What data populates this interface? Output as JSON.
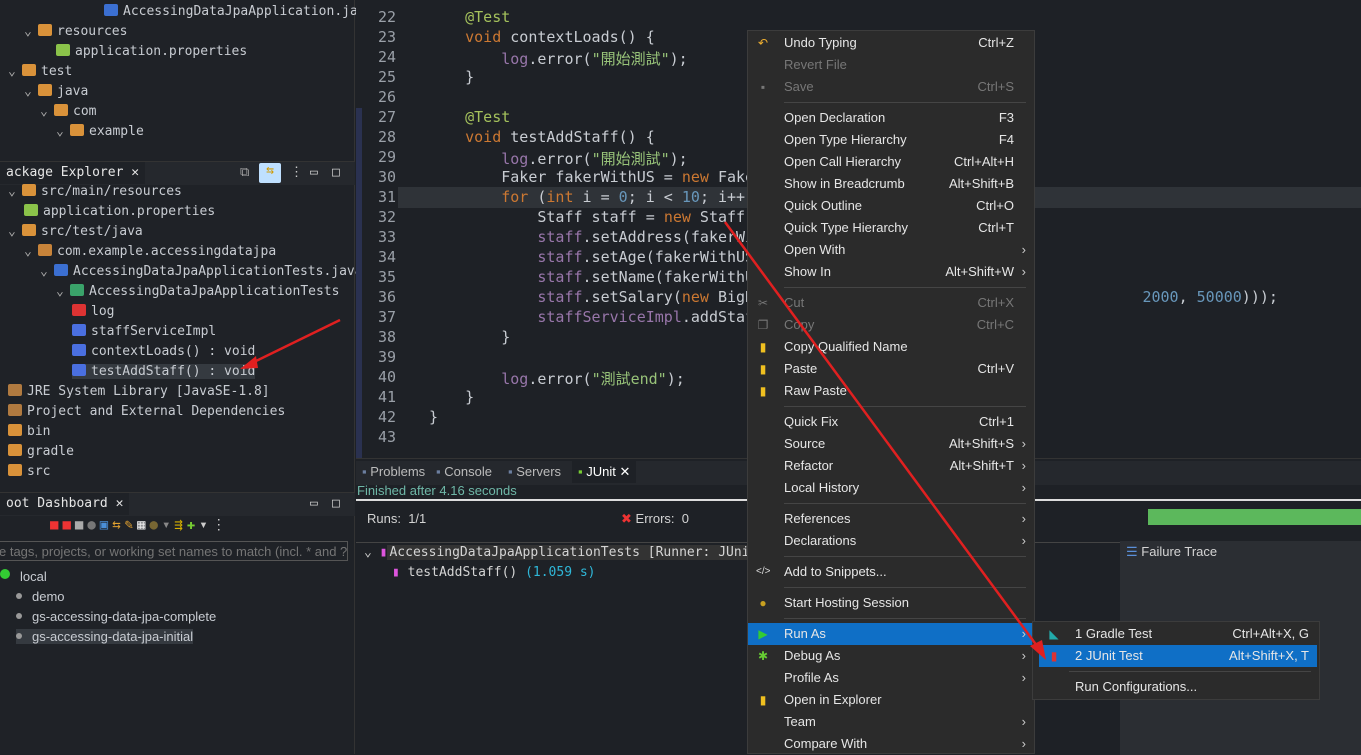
{
  "top_tree": [
    {
      "label": "AccessingDataJpaApplication.java",
      "indent": 104,
      "icon": "java-file-icon"
    },
    {
      "label": "resources",
      "indent": 24,
      "icon": "folder-icon",
      "chev": "v"
    },
    {
      "label": "application.properties",
      "indent": 56,
      "icon": "properties-icon"
    },
    {
      "label": "test",
      "indent": 8,
      "icon": "folder-icon",
      "chev": "v"
    },
    {
      "label": "java",
      "indent": 24,
      "icon": "folder-icon",
      "chev": "v"
    },
    {
      "label": "com",
      "indent": 40,
      "icon": "folder-icon",
      "chev": "v"
    },
    {
      "label": "example",
      "indent": 56,
      "icon": "folder-icon",
      "chev": "v"
    }
  ],
  "package_explorer": {
    "tab": "ackage Explorer",
    "items": [
      {
        "label": "src/main/resources",
        "indent": 8,
        "icon": "source-folder-icon",
        "chev": "v"
      },
      {
        "label": "application.properties",
        "indent": 24,
        "icon": "properties-icon"
      },
      {
        "label": "src/test/java",
        "indent": 8,
        "icon": "source-folder-icon",
        "chev": "v"
      },
      {
        "label": "com.example.accessingdatajpa",
        "indent": 24,
        "icon": "package-icon",
        "chev": "v"
      },
      {
        "label": "AccessingDataJpaApplicationTests.java",
        "indent": 40,
        "icon": "java-file-icon",
        "chev": "v"
      },
      {
        "label": "AccessingDataJpaApplicationTests",
        "indent": 56,
        "icon": "class-icon",
        "chev": "v"
      },
      {
        "label": "log",
        "indent": 72,
        "icon": "static-field-icon"
      },
      {
        "label": "staffServiceImpl",
        "indent": 72,
        "icon": "field-icon"
      },
      {
        "label": "contextLoads() : void",
        "indent": 72,
        "icon": "method-icon"
      },
      {
        "label": "testAddStaff() : void",
        "indent": 72,
        "icon": "method-icon",
        "selected": true
      },
      {
        "label": "JRE System Library [JavaSE-1.8]",
        "indent": 8,
        "icon": "library-icon"
      },
      {
        "label": "Project and External Dependencies",
        "indent": 8,
        "icon": "library-icon"
      },
      {
        "label": "bin",
        "indent": 8,
        "icon": "folder-icon"
      },
      {
        "label": "gradle",
        "indent": 8,
        "icon": "folder-icon"
      },
      {
        "label": "src",
        "indent": 8,
        "icon": "folder-icon"
      }
    ]
  },
  "boot_dashboard": {
    "tab": "oot Dashboard",
    "filter_placeholder": "e tags, projects, or working set names to match (incl. * and ? wi",
    "items": [
      {
        "label": "local",
        "indent": 0,
        "root": true
      },
      {
        "label": "demo",
        "indent": 16
      },
      {
        "label": "gs-accessing-data-jpa-complete",
        "indent": 16
      },
      {
        "label": "gs-accessing-data-jpa-initial",
        "indent": 16,
        "selected": true
      }
    ]
  },
  "editor": {
    "lines": [
      {
        "n": "22",
        "html": "    <span class='an'>@Test</span>"
      },
      {
        "n": "23",
        "html": "    <span class='kw'>void</span> contextLoads() {"
      },
      {
        "n": "24",
        "html": "        <span class='fld'>log</span>.error(<span class='st'>\"開始測試\"</span>);"
      },
      {
        "n": "25",
        "html": "    }"
      },
      {
        "n": "26",
        "html": ""
      },
      {
        "n": "27",
        "html": "    <span class='an'>@Test</span>"
      },
      {
        "n": "28",
        "html": "    <span class='kw'>void</span> testAddStaff() {"
      },
      {
        "n": "29",
        "html": "        <span class='fld'>log</span>.error(<span class='st'>\"開始測試\"</span>);"
      },
      {
        "n": "30",
        "html": "        Faker fakerWithUS = <span class='kw'>new</span> Faker(Locale"
      },
      {
        "n": "31",
        "html": "        <span class='kw'>for</span> (<span class='kw'>int</span> i = <span class='num'>0</span>; i &lt; <span class='num'>10</span>; i++) {"
      },
      {
        "n": "32",
        "html": "            Staff staff = <span class='kw'>new</span> Staff();"
      },
      {
        "n": "33",
        "html": "            <span class='fld'>staff</span>.setAddress(fakerWithUS.add"
      },
      {
        "n": "34",
        "html": "            <span class='fld'>staff</span>.setAge(fakerWithUS.number("
      },
      {
        "n": "35",
        "html": "            <span class='fld'>staff</span>.setName(fakerWithUS.name()"
      },
      {
        "n": "36",
        "html": "            <span class='fld'>staff</span>.setSalary(<span class='kw'>new</span> BigDecimal(f                                   <span class='num'>2000</span>, <span class='num'>50000</span>)));"
      },
      {
        "n": "37",
        "html": "            <span class='fld'>staffServiceImpl</span>.addStaff(staff)"
      },
      {
        "n": "38",
        "html": "        }"
      },
      {
        "n": "39",
        "html": ""
      },
      {
        "n": "40",
        "html": "        <span class='fld'>log</span>.error(<span class='st'>\"測試end\"</span>);"
      },
      {
        "n": "41",
        "html": "    }"
      },
      {
        "n": "42",
        "html": "}"
      },
      {
        "n": "43",
        "html": ""
      }
    ]
  },
  "bottom": {
    "tabs": [
      "Problems",
      "Console",
      "Servers",
      "JUnit"
    ],
    "status": "Finished after 4.16 seconds",
    "runs_label": "Runs:",
    "runs": "1/1",
    "errors_label": "Errors:",
    "errors": "0",
    "progress": 1.0,
    "progress_color": "#5cb85c",
    "failure_trace": "Failure Trace",
    "suite": "AccessingDataJpaApplicationTests [Runner: JUnit 5]",
    "test": "testAddStaff()",
    "time": "(1.059 s)"
  },
  "context_menu": [
    {
      "l": "Undo Typing",
      "s": "Ctrl+Z",
      "icon": "undo-icon"
    },
    {
      "l": "Revert File",
      "dis": true
    },
    {
      "l": "Save",
      "s": "Ctrl+S",
      "dis": true,
      "icon": "save-icon"
    },
    {
      "sep": true
    },
    {
      "l": "Open Declaration",
      "s": "F3"
    },
    {
      "l": "Open Type Hierarchy",
      "s": "F4"
    },
    {
      "l": "Open Call Hierarchy",
      "s": "Ctrl+Alt+H"
    },
    {
      "l": "Show in Breadcrumb",
      "s": "Alt+Shift+B"
    },
    {
      "l": "Quick Outline",
      "s": "Ctrl+O"
    },
    {
      "l": "Quick Type Hierarchy",
      "s": "Ctrl+T"
    },
    {
      "l": "Open With",
      "sub": true
    },
    {
      "l": "Show In",
      "s": "Alt+Shift+W",
      "sub": true
    },
    {
      "sep": true
    },
    {
      "l": "Cut",
      "s": "Ctrl+X",
      "dis": true,
      "icon": "cut-icon"
    },
    {
      "l": "Copy",
      "s": "Ctrl+C",
      "dis": true,
      "icon": "copy-icon"
    },
    {
      "l": "Copy Qualified Name",
      "icon": "copy-qualified-icon"
    },
    {
      "l": "Paste",
      "s": "Ctrl+V",
      "icon": "paste-icon"
    },
    {
      "l": "Raw Paste",
      "icon": "paste-icon"
    },
    {
      "sep": true
    },
    {
      "l": "Quick Fix",
      "s": "Ctrl+1"
    },
    {
      "l": "Source",
      "s": "Alt+Shift+S",
      "sub": true
    },
    {
      "l": "Refactor",
      "s": "Alt+Shift+T",
      "sub": true
    },
    {
      "l": "Local History",
      "sub": true
    },
    {
      "sep": true
    },
    {
      "l": "References",
      "sub": true
    },
    {
      "l": "Declarations",
      "sub": true
    },
    {
      "sep": true
    },
    {
      "l": "Add to Snippets...",
      "icon": "snippet-icon"
    },
    {
      "sep": true
    },
    {
      "l": "Start Hosting Session",
      "icon": "hosting-icon"
    },
    {
      "sep": true
    },
    {
      "l": "Run As",
      "sub": true,
      "sel": true,
      "icon": "run-icon"
    },
    {
      "l": "Debug As",
      "sub": true,
      "icon": "debug-icon"
    },
    {
      "l": "Profile As",
      "sub": true
    },
    {
      "l": "Open in Explorer",
      "icon": "explorer-icon"
    },
    {
      "l": "Team",
      "sub": true
    },
    {
      "l": "Compare With",
      "sub": true
    }
  ],
  "submenu": [
    {
      "l": "1 Gradle Test",
      "s": "Ctrl+Alt+X, G",
      "icon": "gradle-icon"
    },
    {
      "l": "2 JUnit Test",
      "s": "Alt+Shift+X, T",
      "sel": true,
      "icon": "junit-icon"
    },
    {
      "sep": true
    },
    {
      "l": "Run Configurations..."
    }
  ],
  "annotation_color": "#e02020"
}
